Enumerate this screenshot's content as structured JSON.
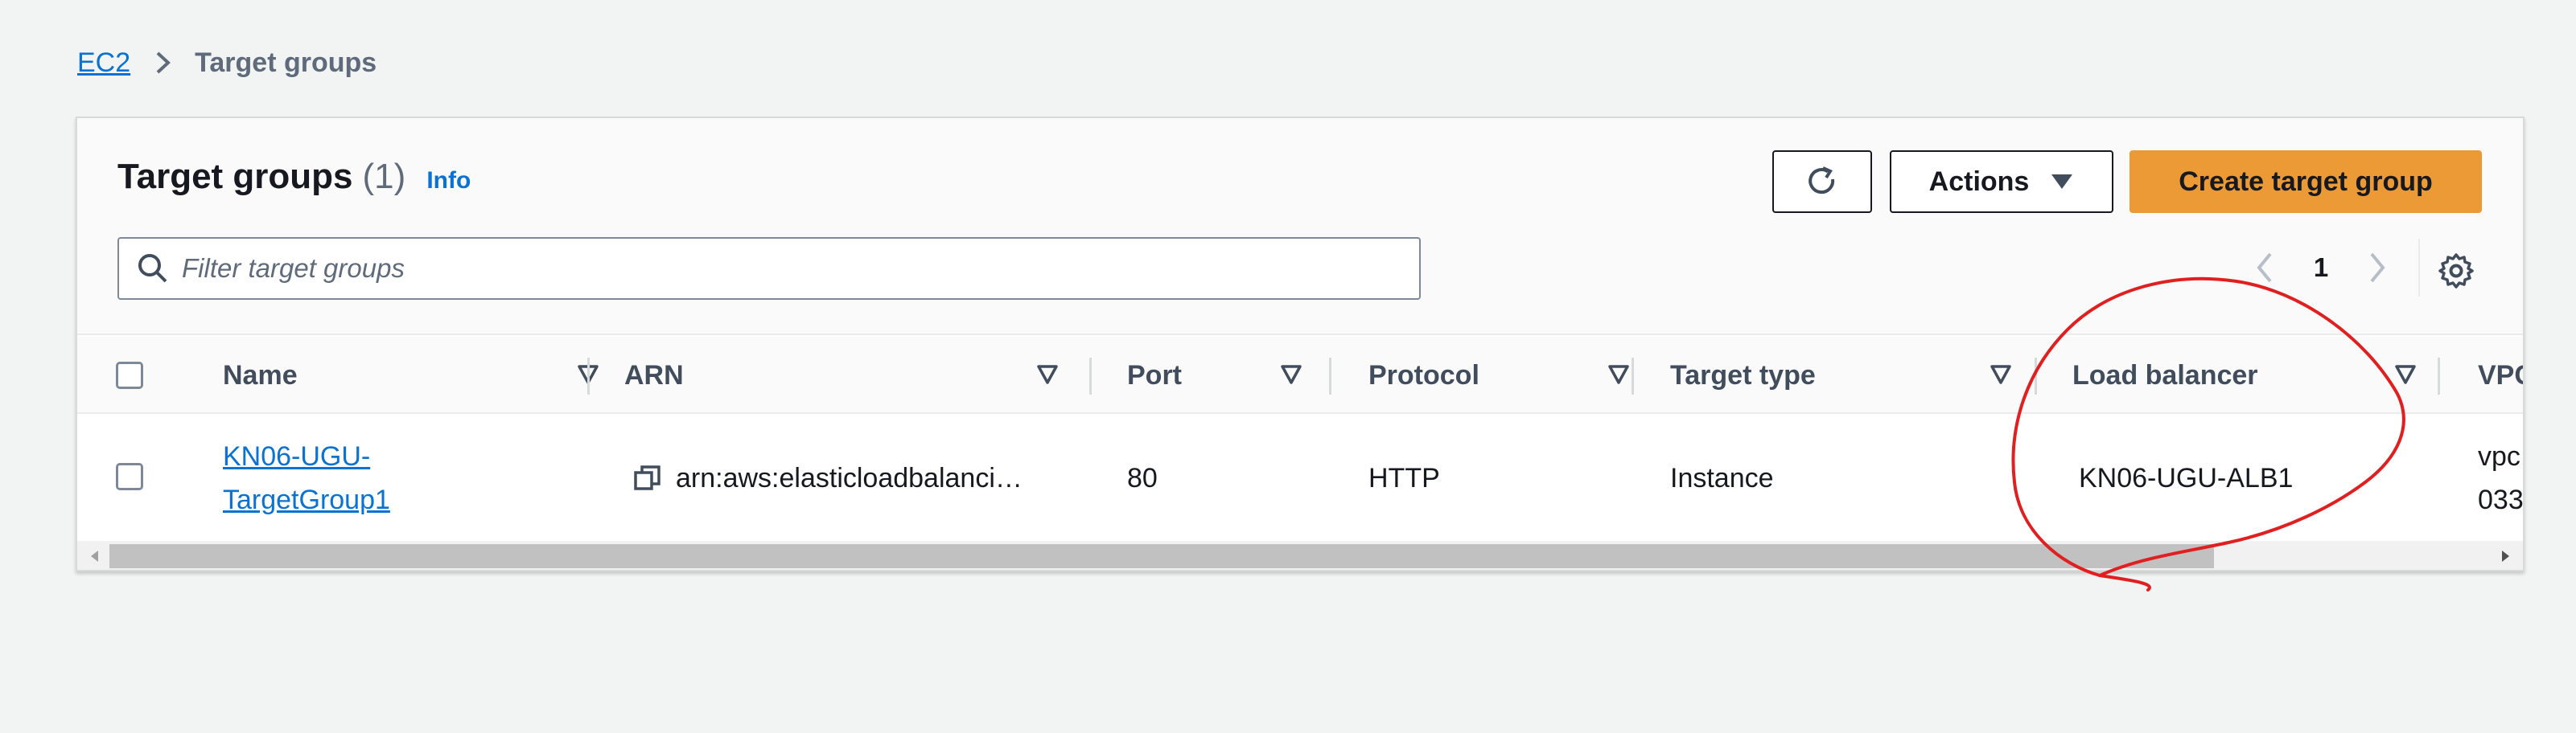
{
  "breadcrumb": {
    "root": "EC2",
    "current": "Target groups"
  },
  "panel": {
    "title": "Target groups",
    "count": "(1)",
    "info": "Info",
    "actions_label": "Actions",
    "create_label": "Create target group",
    "search_placeholder": "Filter target groups",
    "page_number": "1"
  },
  "table": {
    "columns": [
      "Name",
      "ARN",
      "Port",
      "Protocol",
      "Target type",
      "Load balancer",
      "VPC"
    ],
    "rows": [
      {
        "name_line1": "KN06-UGU-",
        "name_line2": "TargetGroup1",
        "arn": "arn:aws:elasticloadbalanci…",
        "port": "80",
        "protocol": "HTTP",
        "target_type": "Instance",
        "load_balancer": "KN06-UGU-ALB1",
        "vpc_line1": "vpc",
        "vpc_line2": "033"
      }
    ]
  },
  "icons": {
    "breadcrumb_separator": "chevron-right-icon",
    "refresh": "refresh-icon",
    "actions_caret": "caret-down-icon",
    "search": "search-icon",
    "prev_page": "chevron-left-icon",
    "next_page": "chevron-right-icon",
    "settings": "gear-icon",
    "sort": "sort-caret-icon",
    "copy": "copy-icon"
  },
  "colors": {
    "link": "#0972d3",
    "primary_button": "#ec9a36",
    "annotation": "#e02020"
  }
}
